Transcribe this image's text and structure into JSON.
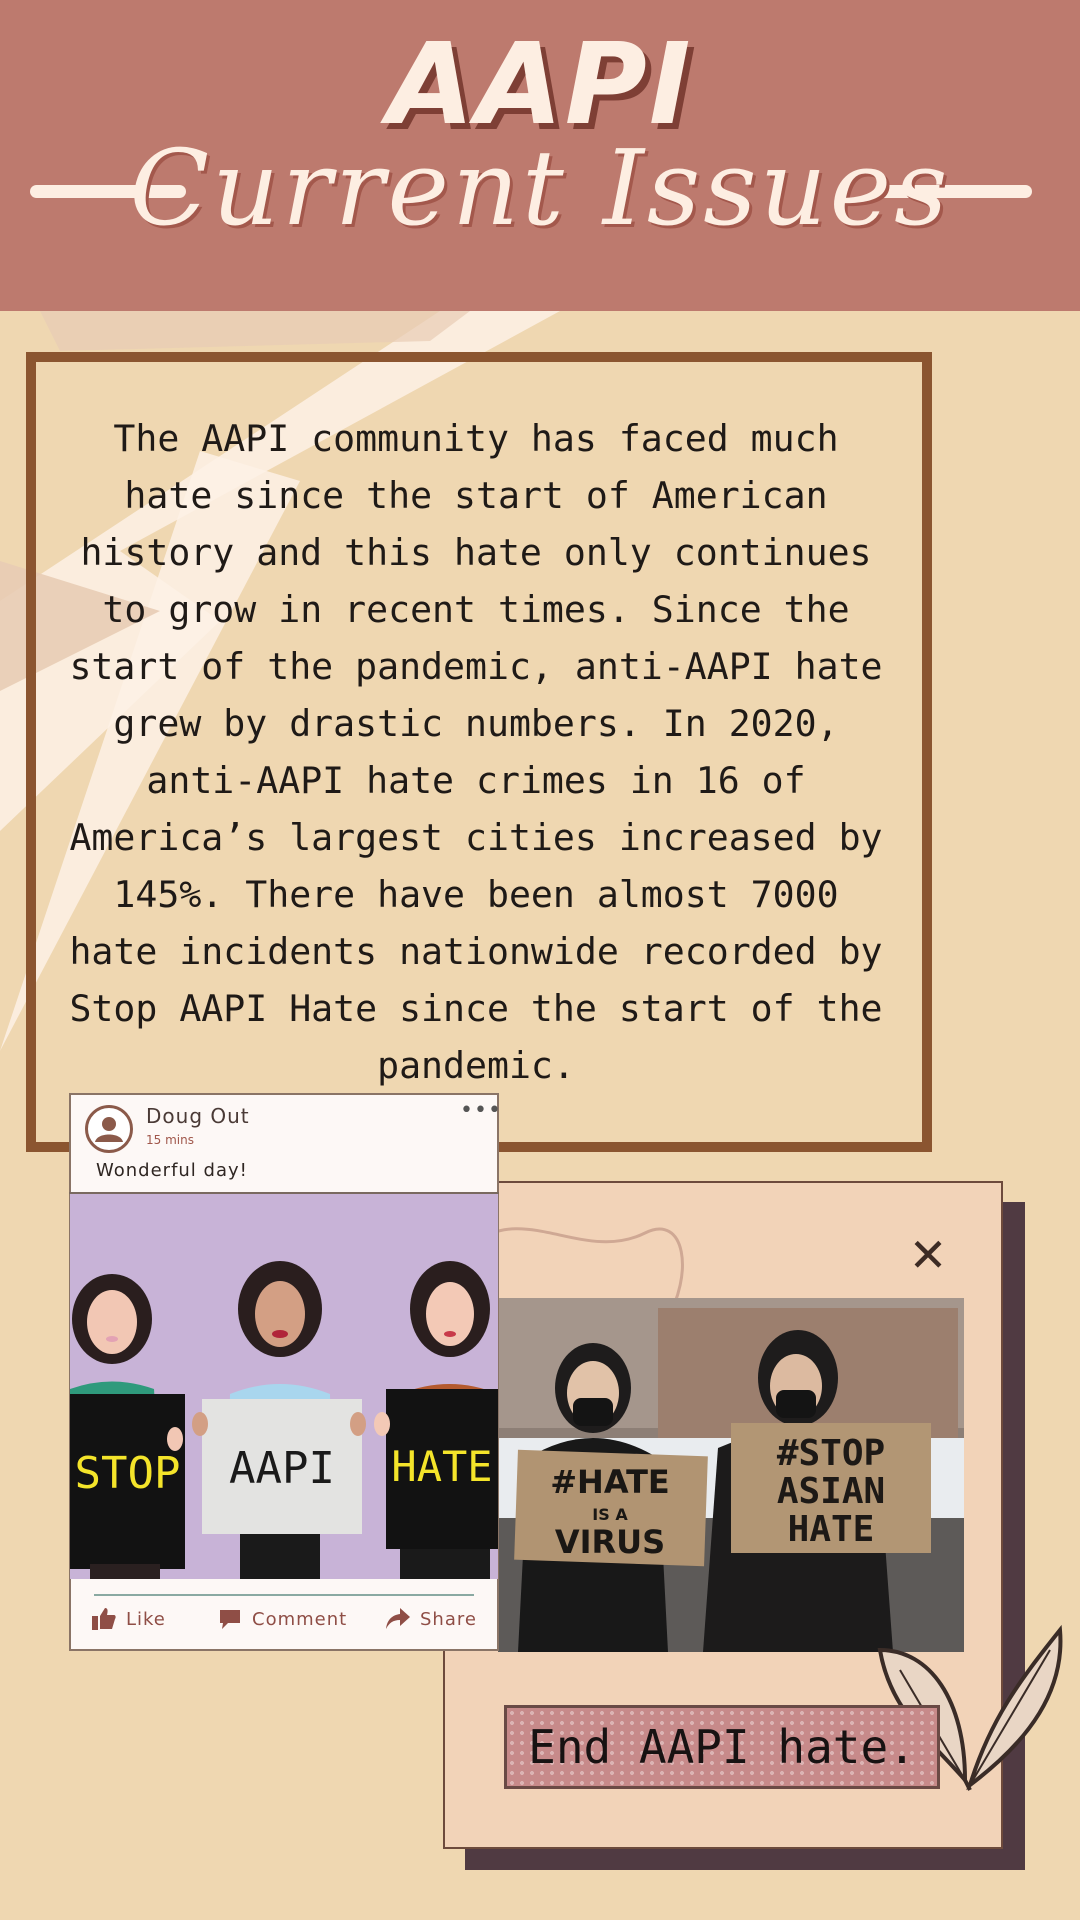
{
  "header": {
    "title": "AAPI",
    "subtitle": "Current Issues"
  },
  "body": {
    "paragraph": "The AAPI community has faced much hate since the start of American history and this hate only continues to grow in recent times. Since the start of the pandemic, anti-AAPI hate grew by drastic numbers. In 2020, anti-AAPI hate crimes in 16 of America’s largest cities increased by 145%. There have been almost 7000 hate incidents nationwide recorded by Stop AAPI Hate since the start of the pandemic."
  },
  "post": {
    "author": "Doug Out",
    "time": "15 mins",
    "caption": "Wonderful day!",
    "signs": [
      "STOP",
      "AAPI",
      "HATE"
    ],
    "actions": {
      "like": "Like",
      "comment": "Comment",
      "share": "Share"
    }
  },
  "photo": {
    "signs": [
      "#HATE IS A VIRUS",
      "#STOP ASIAN HATE"
    ]
  },
  "card": {
    "close_symbol": "✕",
    "banner": "End AAPI hate."
  },
  "colors": {
    "background": "#efd7b1",
    "header": "#bd7a6e",
    "frame": "#8b5530",
    "card": "#f2d3b8",
    "card_shadow": "#503a42",
    "banner": "#c78a8a"
  }
}
